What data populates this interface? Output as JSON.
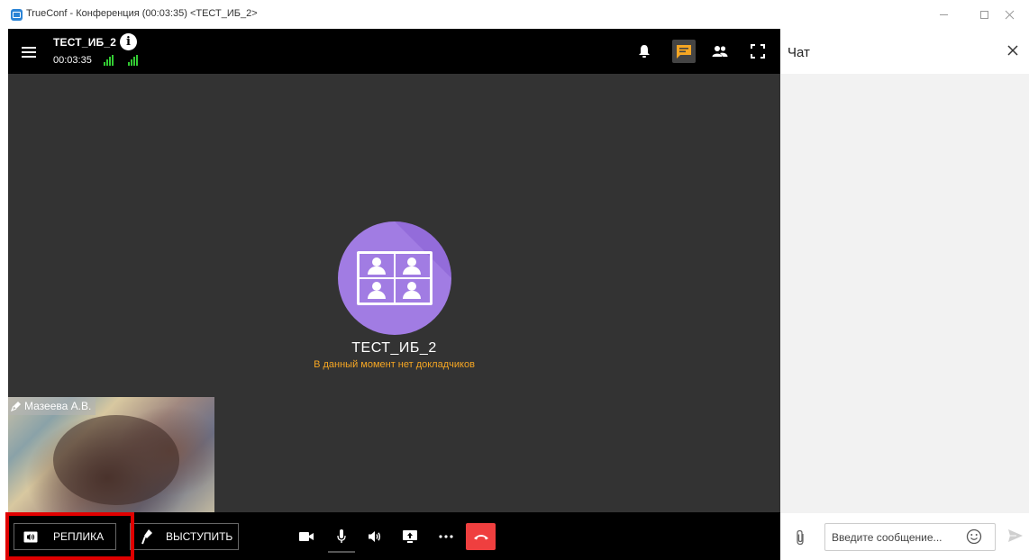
{
  "window": {
    "title": "TrueConf - Конференция (00:03:35) <ТЕСТ_ИБ_2>",
    "app_icon": "trueconf-app-icon"
  },
  "conference": {
    "name": "ТЕСТ_ИБ_2",
    "timer": "00:03:35",
    "center_title": "ТЕСТ_ИБ_2",
    "status_message": "В данный момент нет докладчиков",
    "self_view_name": "Мазеева А.В."
  },
  "toolbar": {
    "remark_label": "РЕПЛИКА",
    "speak_label": "ВЫСТУПИТЬ"
  },
  "chat": {
    "title": "Чат",
    "input_placeholder": "Введите сообщение..."
  },
  "colors": {
    "accent": "#f5a623",
    "hangup": "#ef3f3f",
    "signal": "#33cc33",
    "avatar": "#a17ce3",
    "highlight": "#e00000"
  }
}
